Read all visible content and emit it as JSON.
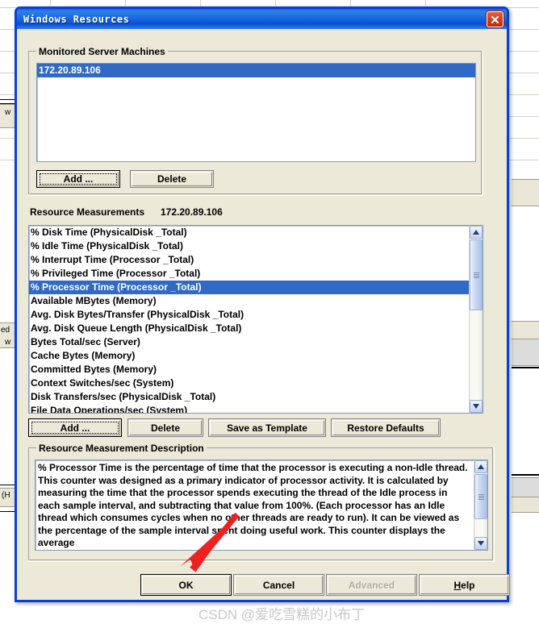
{
  "window": {
    "title": "Windows Resources",
    "close_icon": "close-x-icon"
  },
  "monitored_servers": {
    "group_label": "Monitored Server Machines",
    "items": [
      "172.20.89.106"
    ],
    "selected_index": 0,
    "buttons": [
      {
        "label": "Add ...",
        "enabled": true
      },
      {
        "label": "Delete",
        "enabled": true
      }
    ]
  },
  "resource_measurements": {
    "group_label": "Resource Measurements",
    "machine": "172.20.89.106",
    "items": [
      "% Disk Time (PhysicalDisk _Total)",
      "% Idle Time (PhysicalDisk _Total)",
      "% Interrupt Time (Processor _Total)",
      "% Privileged Time (Processor _Total)",
      "% Processor Time (Processor _Total)",
      "Available MBytes (Memory)",
      "Avg. Disk Bytes/Transfer (PhysicalDisk _Total)",
      "Avg. Disk Queue Length (PhysicalDisk _Total)",
      "Bytes Total/sec (Server)",
      "Cache Bytes (Memory)",
      "Committed Bytes (Memory)",
      "Context Switches/sec (System)",
      "Disk Transfers/sec (PhysicalDisk _Total)",
      "File Data Operations/sec (System)"
    ],
    "selected_index": 4,
    "buttons": [
      {
        "label": "Add ...",
        "enabled": true,
        "focused": true
      },
      {
        "label": "Delete",
        "enabled": true,
        "focused": false
      },
      {
        "label": "Save as Template",
        "enabled": true,
        "focused": false
      },
      {
        "label": "Restore Defaults",
        "enabled": true,
        "focused": false
      }
    ]
  },
  "description": {
    "group_label": "Resource Measurement Description",
    "text": "% Processor Time is the percentage of time that the processor is executing a non-Idle thread.  This counter was designed as a primary indicator of processor activity.  It is calculated by measuring the time that the processor spends executing the thread of the Idle process in each sample interval, and subtracting that value from 100%.  (Each processor has an Idle thread which consumes cycles when no other threads are ready to run). It can be viewed as the percentage of the sample interval spent doing useful work.  This counter displays the average"
  },
  "dialog_buttons": [
    {
      "label": "OK",
      "enabled": true
    },
    {
      "label": "Cancel",
      "enabled": true
    },
    {
      "label": "Advanced",
      "enabled": false
    },
    {
      "label": "Help",
      "enabled": true,
      "accel": "H"
    }
  ],
  "watermark": "CSDN @爱吃雪糕的小布丁",
  "background": {
    "fragments": [
      "w",
      "ed",
      "w",
      "(H"
    ]
  },
  "colors": {
    "title_bar_blue": "#0a4fd0",
    "selection_blue": "#3169c6",
    "dialog_face": "#ece9d8",
    "close_red": "#d23c18",
    "annotation_red": "#f02020"
  }
}
